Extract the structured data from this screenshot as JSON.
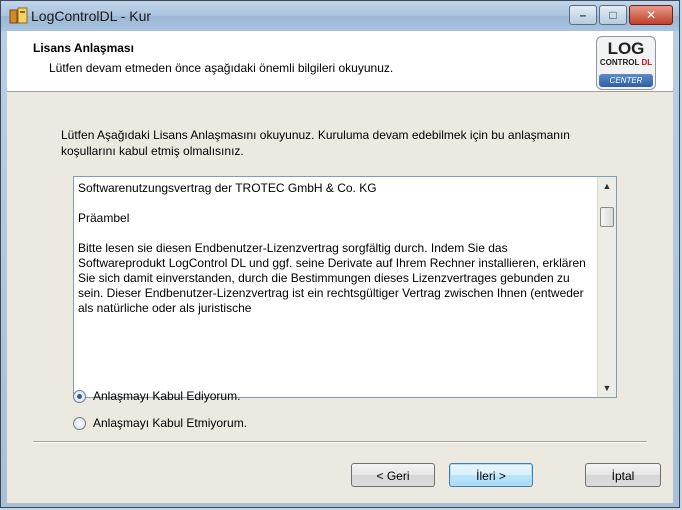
{
  "window": {
    "title": "LogControlDL - Kur",
    "icon": "installer-icon",
    "controls": {
      "minimize": "–",
      "maximize": "□",
      "close": "✕"
    }
  },
  "header": {
    "title": "Lisans Anlaşması",
    "subtitle": "Lütfen devam etmeden önce aşağıdaki önemli bilgileri okuyunuz.",
    "logo": {
      "line1": "LOG",
      "line2a": "CONTROL ",
      "line2b": "DL",
      "line3": "CENTER"
    }
  },
  "intro_text": "Lütfen Aşağıdaki Lisans Anlaşmasını okuyunuz. Kuruluma devam edebilmek için bu anlaşmanın koşullarını kabul etmiş olmalısınız.",
  "license": {
    "paragraphs": [
      "Softwarenutzungsvertrag der TROTEC GmbH & Co. KG",
      "Präambel",
      "Bitte lesen sie diesen Endbenutzer-Lizenzvertrag sorgfältig durch. Indem Sie das Softwareprodukt LogControl DL und ggf. seine Derivate auf Ihrem Rechner installieren, erklären Sie sich damit einverstanden, durch die Bestimmungen dieses Lizenzvertrages gebunden zu sein. Dieser Endbenutzer-Lizenzvertrag ist ein rechtsgültiger Vertrag zwischen Ihnen (entweder als natürliche oder als juristische"
    ]
  },
  "options": {
    "accept": {
      "label": "Anlaşmayı Kabul Ediyorum.",
      "selected": true
    },
    "decline": {
      "label": "Anlaşmayı Kabul Etmiyorum.",
      "selected": false
    }
  },
  "buttons": {
    "back": "< Geri",
    "next": "İleri >",
    "cancel": "İptal"
  },
  "colors": {
    "accent": "#2c5fa0",
    "logo_red": "#c8141e"
  }
}
